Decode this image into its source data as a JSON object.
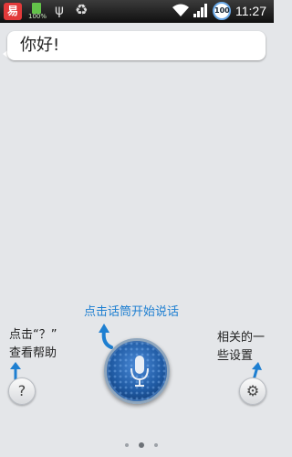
{
  "status_bar": {
    "app_icon_text": "易",
    "battery_small_text": "100%",
    "usb_icon": "usb-icon",
    "recycle_icon": "recycle-icon",
    "battery_circle_text": "100",
    "time": "11:27"
  },
  "chat": {
    "greeting": "你好!"
  },
  "hints": {
    "center": "点击话筒开始说话",
    "left_line1": "点击“？”",
    "left_line2": "查看帮助",
    "right_line1": "相关的一",
    "right_line2": "些设置"
  },
  "buttons": {
    "help_label": "?",
    "settings_icon": "gear-icon",
    "mic_icon": "microphone-icon"
  },
  "pager": {
    "count": 3,
    "active_index": 1
  },
  "colors": {
    "accent": "#1e7fd1",
    "background": "#e4e6e9",
    "status_bar": "#1a1a1a"
  }
}
